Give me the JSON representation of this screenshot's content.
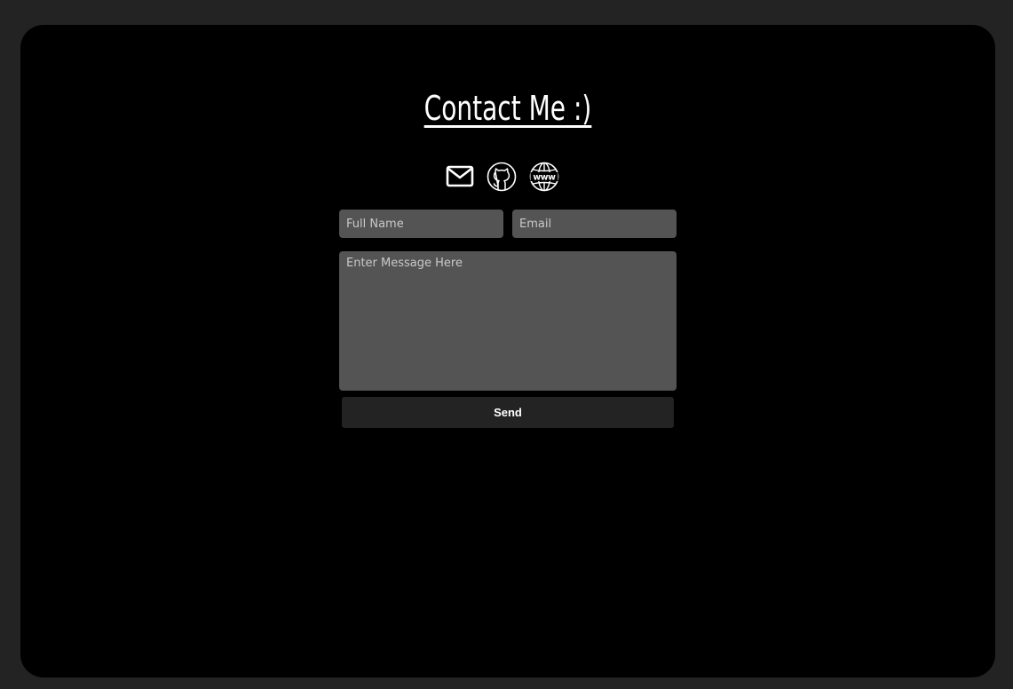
{
  "page": {
    "title": "Contact Me :)"
  },
  "contact_links": [
    {
      "icon": "mail-icon"
    },
    {
      "icon": "github-icon"
    },
    {
      "icon": "globe-www-icon"
    }
  ],
  "form": {
    "full_name_placeholder": "Full Name",
    "email_placeholder": "Email",
    "message_placeholder": "Enter Message Here",
    "send_label": "Send"
  },
  "colors": {
    "page_background": "#232323",
    "card_background": "#000000",
    "field_background": "#545454",
    "button_background": "#232323",
    "text": "#ffffff"
  }
}
